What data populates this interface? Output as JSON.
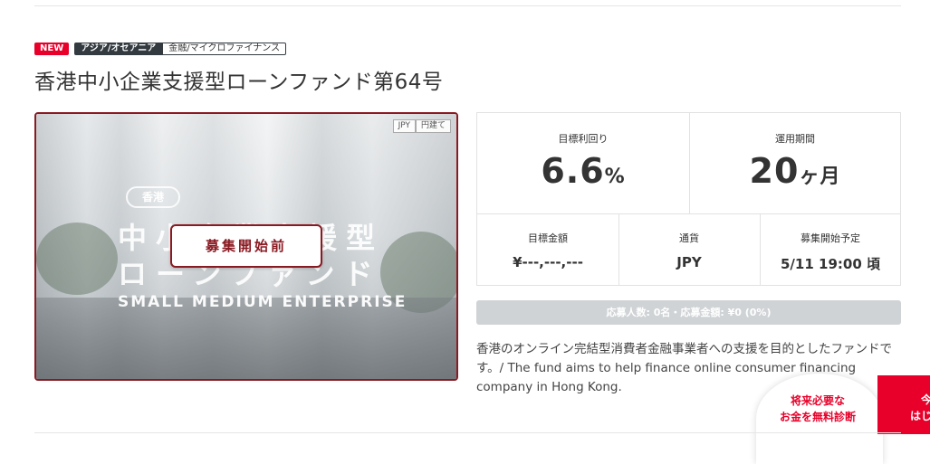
{
  "tags": {
    "new": "NEW",
    "region": "アジア/オセアニア",
    "category": "金融/マイクロファイナンス"
  },
  "fund": {
    "title": "香港中小企業支援型ローンファンド第64号",
    "hero": {
      "pill": "香港",
      "line1": "中小企業支援型",
      "line2": "ローンファンド",
      "english": "SMALL MEDIUM ENTERPRISE",
      "badge_currency": "JPY",
      "badge_yen": "円建て",
      "status_button": "募集開始前"
    },
    "stats": {
      "yield_label": "目標利回り",
      "yield_value": "6.6",
      "yield_unit": "%",
      "term_label": "運用期間",
      "term_value": "20",
      "term_unit": "ヶ月",
      "amount_label": "目標金額",
      "amount_value": "¥---,---,---",
      "currency_label": "通貨",
      "currency_value": "JPY",
      "start_label": "募集開始予定",
      "start_value": "5/11 19:00 頃"
    },
    "progress": {
      "text": "応募人数: 0名・応募金額: ¥0 (0%)",
      "percent": 0
    },
    "description": "香港のオンライン完結型消費者金融事業者への支援を目的としたファンドです。/ The fund aims to help finance online consumer financing company in Hong Kong."
  },
  "cta": {
    "line1": "将来必要な",
    "line2": "お金を無料診断",
    "side_line1": "今",
    "side_line2": "はじ"
  },
  "colors": {
    "accent_red": "#e8002a",
    "dark_red": "#8a1a22",
    "dark_tag": "#333a40"
  }
}
